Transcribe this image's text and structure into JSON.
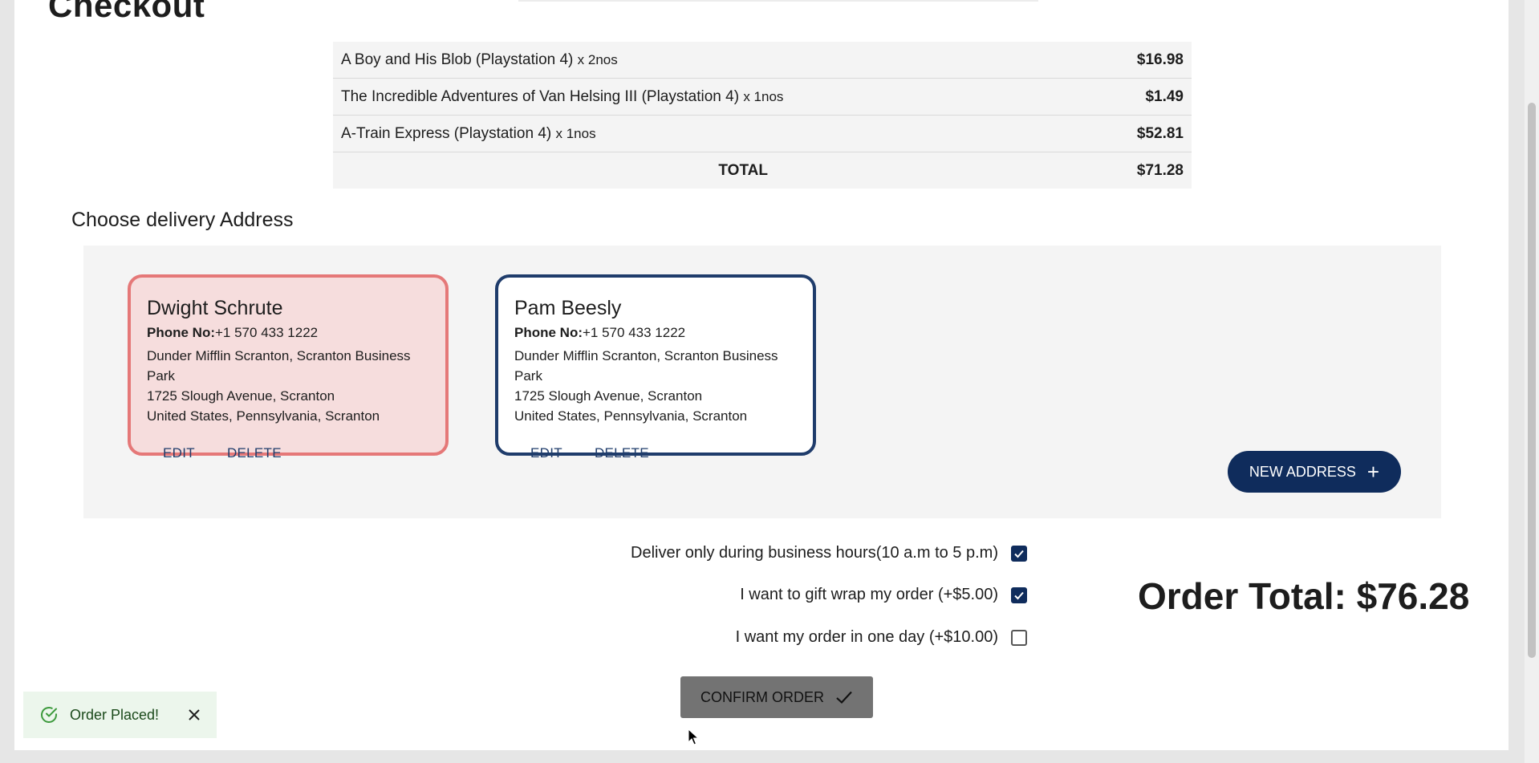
{
  "page": {
    "title": "Checkout"
  },
  "order_summary": {
    "rows": [
      {
        "item": "A Boy and His Blob (Playstation 4)",
        "qty": "x 2nos",
        "price": "$16.98"
      },
      {
        "item": "The Incredible Adventures of Van Helsing III (Playstation 4)",
        "qty": "x 1nos",
        "price": "$1.49"
      },
      {
        "item": "A-Train Express (Playstation 4)",
        "qty": "x 1nos",
        "price": "$52.81"
      }
    ],
    "total_label": "TOTAL",
    "total_value": "$71.28"
  },
  "delivery": {
    "heading": "Choose delivery Address",
    "addresses": [
      {
        "name": "Dwight Schrute",
        "phone_label": "Phone No:",
        "phone": "+1 570 433 1222",
        "line1": "Dunder Mifflin Scranton, Scranton Business Park",
        "line2": "1725 Slough Avenue, Scranton",
        "line3": "United States, Pennsylvania, Scranton",
        "edit_label": "EDIT",
        "delete_label": "DELETE",
        "selected": true
      },
      {
        "name": "Pam Beesly",
        "phone_label": "Phone No:",
        "phone": "+1 570 433 1222",
        "line1": "Dunder Mifflin Scranton, Scranton Business Park",
        "line2": "1725 Slough Avenue, Scranton",
        "line3": "United States, Pennsylvania, Scranton",
        "edit_label": "EDIT",
        "delete_label": "DELETE",
        "selected": false
      }
    ],
    "new_address_label": "NEW ADDRESS"
  },
  "options": [
    {
      "label": "Deliver only during business hours(10 a.m to 5 p.m)",
      "checked": true
    },
    {
      "label": "I want to gift wrap my order (+$5.00)",
      "checked": true
    },
    {
      "label": "I want my order in one day (+$10.00)",
      "checked": false
    }
  ],
  "order_total": "Order Total: $76.28",
  "confirm_label": "CONFIRM ORDER",
  "toast": {
    "message": "Order Placed!"
  },
  "colors": {
    "primary": "#0f2c5c",
    "card_border": "#1f3c6b",
    "selected_border": "#e57878",
    "selected_bg": "#f6dddd",
    "toast_bg": "#ecf6ec",
    "toast_icon": "#3d9a3d",
    "confirm_bg": "#737373"
  },
  "icons": {
    "checkbox": "check-icon",
    "new_address": "plus-icon",
    "confirm": "check-icon",
    "toast": "success-check-icon",
    "toast_close": "close-icon"
  }
}
